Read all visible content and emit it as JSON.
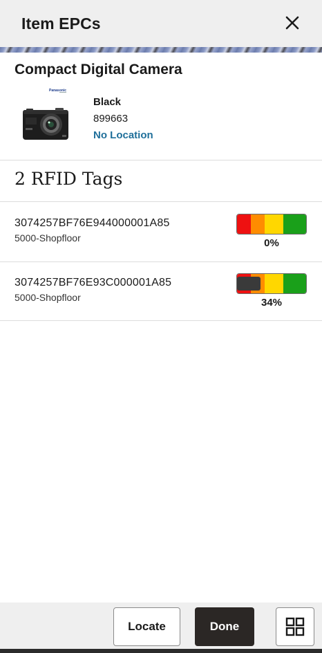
{
  "header": {
    "title": "Item EPCs",
    "close_icon": "close-icon"
  },
  "product": {
    "name": "Compact Digital Camera",
    "brand": "Panasonic",
    "color": "Black",
    "sku": "899663",
    "location": "No Location"
  },
  "tags": {
    "heading": "2 RFID Tags",
    "items": [
      {
        "epc": "3074257BF76E944000001A85",
        "location": "5000-Shopfloor",
        "signal_label": "0%",
        "signal": 0
      },
      {
        "epc": "3074257BF76E93C000001A85",
        "location": "5000-Shopfloor",
        "signal_label": "34%",
        "signal": 34
      }
    ]
  },
  "footer": {
    "locate_label": "Locate",
    "done_label": "Done",
    "grid_icon": "grid-icon"
  },
  "colors": {
    "link": "#1f6f9a",
    "meter_red": "#ee1111",
    "meter_orange": "#ff8c00",
    "meter_yellow": "#ffd700",
    "meter_green": "#1aa01a",
    "primary_button": "#2b2725"
  }
}
